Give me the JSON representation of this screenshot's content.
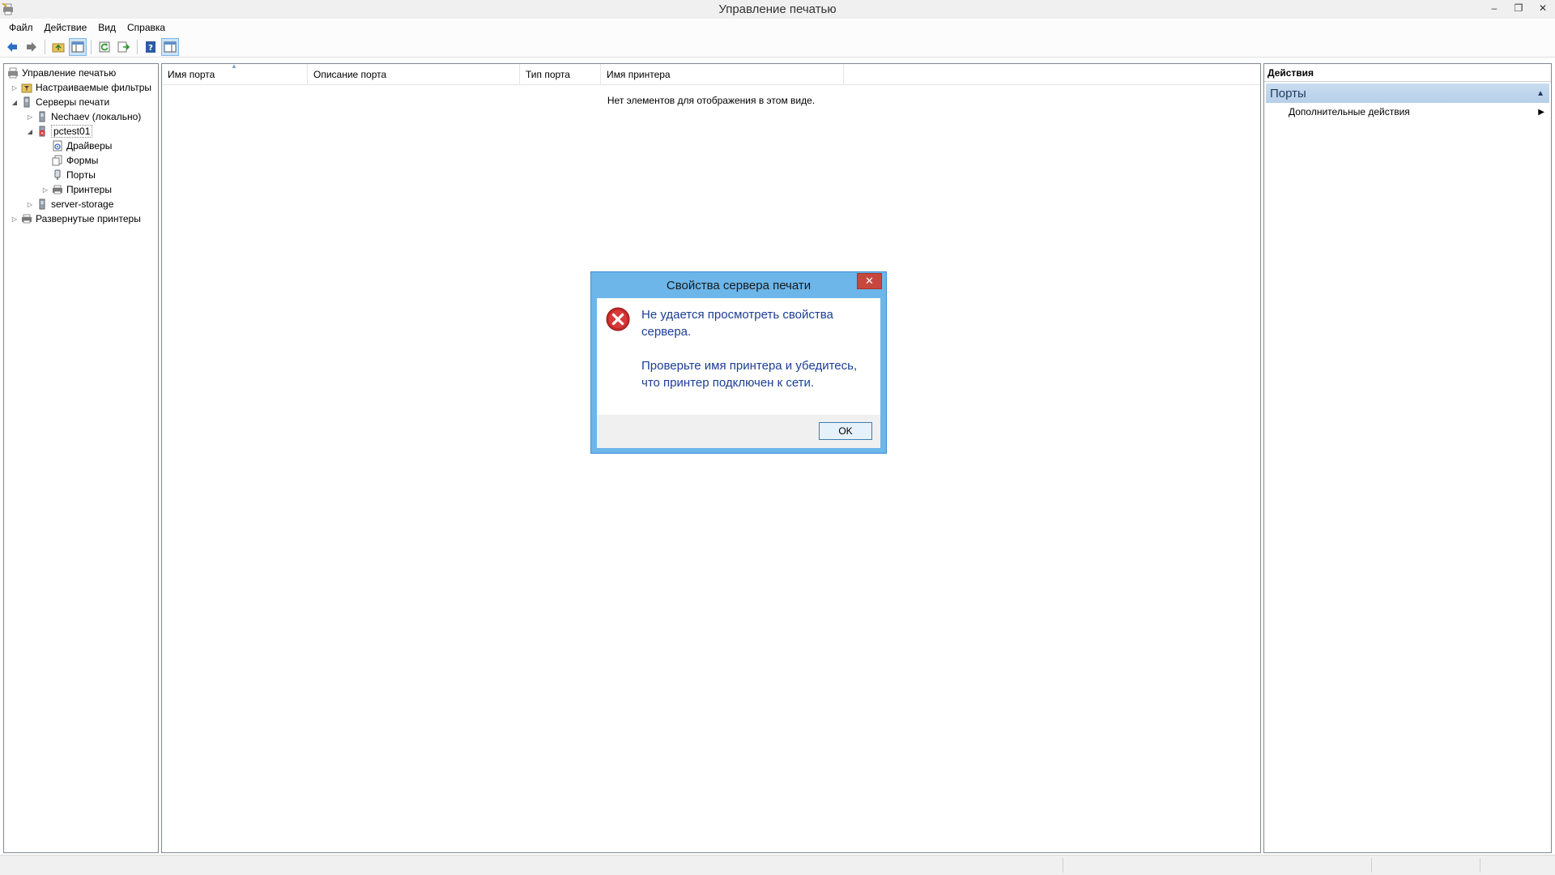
{
  "window": {
    "title": "Управление печатью",
    "minimize": "–",
    "restore": "❐",
    "close": "✕"
  },
  "menu": [
    "Файл",
    "Действие",
    "Вид",
    "Справка"
  ],
  "toolbar": {
    "buttons": [
      "back-icon",
      "forward-icon",
      "up-folder-icon",
      "show-hide-console-tree-icon",
      "refresh-icon",
      "export-list-icon",
      "help-icon",
      "show-hide-action-pane-icon"
    ]
  },
  "tree": {
    "root": "Управление печатью",
    "custom_filters": "Настраиваемые фильтры",
    "print_servers": "Серверы печати",
    "server_local": "Nechaev (локально)",
    "server_pctest": "pctest01",
    "drivers": "Драйверы",
    "forms": "Формы",
    "ports": "Порты",
    "printers": "Принтеры",
    "server_storage": "server-storage",
    "deployed_printers": "Развернутые принтеры"
  },
  "list": {
    "columns": [
      "Имя порта",
      "Описание порта",
      "Тип порта",
      "Имя принтера"
    ],
    "empty_message": "Нет элементов для отображения в этом виде."
  },
  "actions": {
    "header": "Действия",
    "group": "Порты",
    "more_actions": "Дополнительные действия"
  },
  "dialog": {
    "title": "Свойства сервера печати",
    "message_1": "Не удается просмотреть свойства сервера.",
    "message_2": "Проверьте имя принтера и убедитесь, что принтер подключен к сети.",
    "ok": "OK"
  },
  "colors": {
    "dialog_frame": "#6cb6ea",
    "dialog_text": "#1c3f94",
    "close_red": "#c7473f",
    "actions_group_bg": "#c9dcf0"
  }
}
